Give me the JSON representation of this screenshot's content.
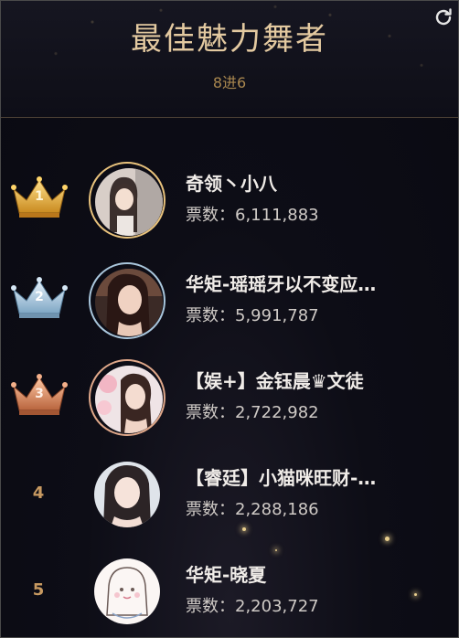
{
  "header": {
    "title": "最佳魅力舞者",
    "subtitle": "8进6",
    "refresh_icon": "refresh-icon"
  },
  "colors": {
    "gold": "#e8b54a",
    "silver": "#9fc3de",
    "bronze": "#d98c63",
    "rank_number": "#c89a61",
    "title": "#e3c9a0"
  },
  "ranking": [
    {
      "rank": "1",
      "badge": "gold-crown-icon",
      "name": "奇领丶小八",
      "votes_label": "票数：",
      "votes": "6,111,883"
    },
    {
      "rank": "2",
      "badge": "silver-crown-icon",
      "name": "华矩-瑶瑶牙以不变应…",
      "votes_label": "票数：",
      "votes": "5,991,787"
    },
    {
      "rank": "3",
      "badge": "bronze-crown-icon",
      "name": "【娱+】金钰晨♛文徒",
      "votes_label": "票数：",
      "votes": "2,722,982"
    },
    {
      "rank": "4",
      "badge": "",
      "name": "【睿廷】小猫咪旺财-…",
      "votes_label": "票数：",
      "votes": "2,288,186"
    },
    {
      "rank": "5",
      "badge": "",
      "name": "华矩-晓夏",
      "votes_label": "票数：",
      "votes": "2,203,727"
    }
  ]
}
